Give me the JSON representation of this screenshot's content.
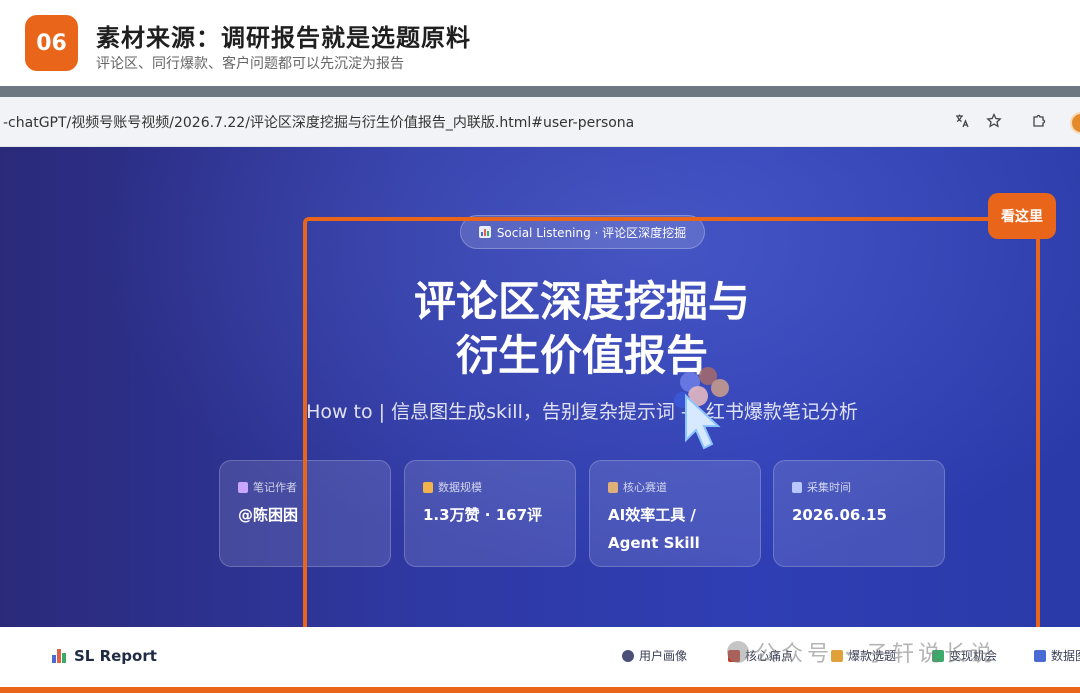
{
  "slide": {
    "number": "06",
    "title": "素材来源：调研报告就是选题原料",
    "subtitle": "评论区、同行爆款、客户问题都可以先沉淀为报告"
  },
  "browser": {
    "url": "-chatGPT/视频号账号视频/2026.7.22/评论区深度挖掘与衍生价值报告_内联版.html#user-persona",
    "icons": [
      "translate-icon",
      "star-icon",
      "extensions-icon",
      "profile-avatar"
    ]
  },
  "hero": {
    "pill": "Social Listening · 评论区深度挖掘",
    "title_line1": "评论区深度挖掘与",
    "title_line2": "衍生价值报告",
    "subtitle": "How to | 信息图生成skill，告别复杂提示词 — 红书爆款笔记分析",
    "cards": [
      {
        "label": "笔记作者",
        "value": "@陈困困",
        "icon_color": "#c9a6ff"
      },
      {
        "label": "数据规模",
        "value": "1.3万赞 · 167评",
        "icon_color": "#f3b24a"
      },
      {
        "label": "核心赛道",
        "value": "AI效率工具 / Agent Skill",
        "icon_color": "#e0b07a"
      },
      {
        "label": "采集时间",
        "value": "2026.06.15",
        "icon_color": "#b9c7ff"
      }
    ]
  },
  "callout": {
    "label": "看这里",
    "color": "#e8651a"
  },
  "footer": {
    "logo": "SL Report",
    "nav": [
      "用户画像",
      "核心痛点",
      "爆款选题",
      "变现机会",
      "数据图"
    ]
  },
  "watermark": "公众号 · 子轩说长说"
}
